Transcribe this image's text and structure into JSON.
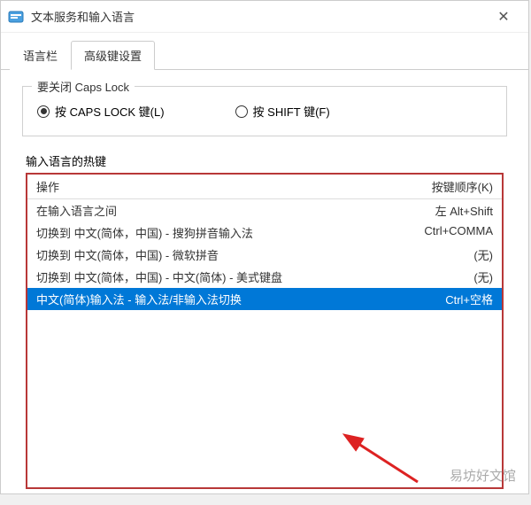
{
  "window": {
    "title": "文本服务和输入语言"
  },
  "tabs": {
    "t0": "语言栏",
    "t1": "高级键设置"
  },
  "capslock": {
    "group_title": "要关闭 Caps Lock",
    "opt_capslock": "按 CAPS LOCK 键(L)",
    "opt_shift": "按 SHIFT 键(F)"
  },
  "hotkeys": {
    "section_label": "输入语言的热键",
    "header_action": "操作",
    "header_key": "按键顺序(K)",
    "rows": {
      "r0": {
        "action": "在输入语言之间",
        "key": "左 Alt+Shift"
      },
      "r1": {
        "action": "切换到 中文(简体，中国) - 搜狗拼音输入法",
        "key": "Ctrl+COMMA"
      },
      "r2": {
        "action": "切换到 中文(简体，中国) - 微软拼音",
        "key": "(无)"
      },
      "r3": {
        "action": "切换到 中文(简体，中国) - 中文(简体) - 美式键盘",
        "key": "(无)"
      },
      "r4": {
        "action": "中文(简体)输入法 - 输入法/非输入法切换",
        "key": "Ctrl+空格"
      }
    }
  },
  "watermark": "易坊好文馆"
}
